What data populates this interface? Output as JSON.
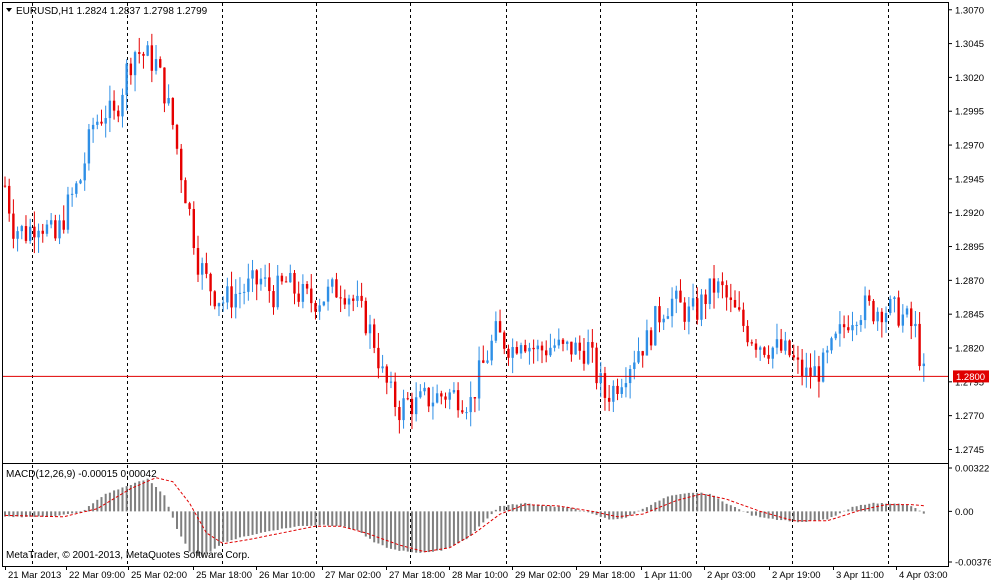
{
  "chart_data": [
    {
      "type": "candlestick",
      "symbol_header": "EURUSD,H1  1.2824 1.2837 1.2798 1.2799",
      "y_ticks": [
        "1.3070",
        "1.3045",
        "1.3020",
        "1.2995",
        "1.2970",
        "1.2945",
        "1.2920",
        "1.2895",
        "1.2870",
        "1.2845",
        "1.2820",
        "1.2795",
        "1.2770",
        "1.2745"
      ],
      "ylim": [
        1.2735,
        1.3075
      ],
      "current_price": "1.2800",
      "current_price_value": 1.2799,
      "x_ticks": [
        "21 Mar 2013",
        "22 Mar 09:00",
        "25 Mar 02:00",
        "25 Mar 18:00",
        "26 Mar 10:00",
        "27 Mar 02:00",
        "27 Mar 18:00",
        "28 Mar 10:00",
        "29 Mar 02:00",
        "29 Mar 18:00",
        "1 Apr 11:00",
        "2 Apr 03:00",
        "2 Apr 19:00",
        "3 Apr 11:00",
        "4 Apr 03:00"
      ],
      "close_path": [
        [
          0,
          1.294
        ],
        [
          2,
          1.291
        ],
        [
          5,
          1.2905
        ],
        [
          8,
          1.2915
        ],
        [
          12,
          1.29
        ],
        [
          15,
          1.2925
        ],
        [
          18,
          1.2945
        ],
        [
          21,
          1.2985
        ],
        [
          24,
          1.2995
        ],
        [
          26,
          1.299
        ],
        [
          29,
          1.3025
        ],
        [
          31,
          1.304
        ],
        [
          34,
          1.3035
        ],
        [
          36,
          1.303
        ],
        [
          38,
          1.301
        ],
        [
          40,
          1.2985
        ],
        [
          42,
          1.295
        ],
        [
          44,
          1.292
        ],
        [
          46,
          1.2885
        ],
        [
          48,
          1.287
        ],
        [
          50,
          1.286
        ],
        [
          52,
          1.2855
        ],
        [
          55,
          1.286
        ],
        [
          58,
          1.2865
        ],
        [
          61,
          1.287
        ],
        [
          64,
          1.286
        ],
        [
          67,
          1.2868
        ],
        [
          70,
          1.286
        ],
        [
          73,
          1.2855
        ],
        [
          76,
          1.2858
        ],
        [
          78,
          1.2862
        ],
        [
          80,
          1.2865
        ],
        [
          82,
          1.286
        ],
        [
          84,
          1.285
        ],
        [
          86,
          1.284
        ],
        [
          88,
          1.2825
        ],
        [
          90,
          1.28
        ],
        [
          92,
          1.2785
        ],
        [
          94,
          1.2775
        ],
        [
          96,
          1.278
        ],
        [
          98,
          1.2778
        ],
        [
          100,
          1.2782
        ],
        [
          102,
          1.2783
        ],
        [
          105,
          1.2786
        ],
        [
          108,
          1.2785
        ],
        [
          111,
          1.278
        ],
        [
          113,
          1.28
        ],
        [
          115,
          1.2815
        ],
        [
          117,
          1.283
        ],
        [
          119,
          1.2825
        ],
        [
          121,
          1.282
        ],
        [
          123,
          1.283
        ],
        [
          125,
          1.2822
        ],
        [
          127,
          1.2818
        ],
        [
          129,
          1.282
        ],
        [
          131,
          1.2822
        ],
        [
          133,
          1.2818
        ],
        [
          135,
          1.282
        ],
        [
          137,
          1.2818
        ],
        [
          139,
          1.282
        ],
        [
          141,
          1.28
        ],
        [
          143,
          1.2785
        ],
        [
          145,
          1.279
        ],
        [
          147,
          1.28
        ],
        [
          149,
          1.281
        ],
        [
          151,
          1.282
        ],
        [
          153,
          1.2825
        ],
        [
          155,
          1.284
        ],
        [
          157,
          1.285
        ],
        [
          159,
          1.2855
        ],
        [
          161,
          1.285
        ],
        [
          163,
          1.2845
        ],
        [
          165,
          1.2848
        ],
        [
          167,
          1.2858
        ],
        [
          169,
          1.2865
        ],
        [
          171,
          1.2862
        ],
        [
          173,
          1.285
        ],
        [
          175,
          1.2842
        ],
        [
          177,
          1.2832
        ],
        [
          179,
          1.2826
        ],
        [
          181,
          1.2822
        ],
        [
          183,
          1.282
        ],
        [
          185,
          1.2818
        ],
        [
          187,
          1.2815
        ],
        [
          189,
          1.2805
        ],
        [
          191,
          1.28
        ],
        [
          193,
          1.2802
        ],
        [
          195,
          1.2806
        ],
        [
          197,
          1.2818
        ],
        [
          199,
          1.283
        ],
        [
          201,
          1.2842
        ],
        [
          203,
          1.2848
        ],
        [
          205,
          1.285
        ],
        [
          207,
          1.2848
        ],
        [
          209,
          1.285
        ],
        [
          211,
          1.2848
        ],
        [
          213,
          1.2846
        ],
        [
          215,
          1.284
        ],
        [
          217,
          1.2832
        ],
        [
          219,
          1.2799
        ]
      ],
      "bars_count": 220
    },
    {
      "type": "macd",
      "label": "MACD(12,26,9) -0.00015 0.00042",
      "y_ticks": [
        "0.00322",
        "0.00",
        "-0.00376"
      ],
      "ylim": [
        -0.00376,
        0.00322
      ],
      "hist_path": [
        [
          0,
          -0.0004
        ],
        [
          10,
          -0.0004
        ],
        [
          18,
          -0.0001
        ],
        [
          24,
          0.0013
        ],
        [
          31,
          0.0021
        ],
        [
          34,
          0.0024
        ],
        [
          38,
          0.0012
        ],
        [
          41,
          -0.0013
        ],
        [
          44,
          -0.003
        ],
        [
          47,
          -0.0034
        ],
        [
          52,
          -0.0023
        ],
        [
          58,
          -0.0018
        ],
        [
          64,
          -0.0014
        ],
        [
          70,
          -0.0011
        ],
        [
          76,
          -0.001
        ],
        [
          80,
          -0.0011
        ],
        [
          84,
          -0.0014
        ],
        [
          88,
          -0.0023
        ],
        [
          92,
          -0.0028
        ],
        [
          98,
          -0.0031
        ],
        [
          104,
          -0.0029
        ],
        [
          110,
          -0.0021
        ],
        [
          114,
          -0.0008
        ],
        [
          118,
          0.0004
        ],
        [
          124,
          0.0006
        ],
        [
          130,
          0.0004
        ],
        [
          136,
          0.0002
        ],
        [
          140,
          -0.0002
        ],
        [
          144,
          -0.0006
        ],
        [
          148,
          -0.0005
        ],
        [
          152,
          0.0002
        ],
        [
          158,
          0.0011
        ],
        [
          164,
          0.0014
        ],
        [
          168,
          0.0013
        ],
        [
          172,
          0.0006
        ],
        [
          178,
          -0.0003
        ],
        [
          184,
          -0.0006
        ],
        [
          190,
          -0.0008
        ],
        [
          196,
          -0.0006
        ],
        [
          202,
          0.0003
        ],
        [
          206,
          0.0006
        ],
        [
          212,
          0.0006
        ],
        [
          216,
          0.0004
        ],
        [
          219,
          -0.00015
        ]
      ],
      "signal_path": [
        [
          0,
          -0.0003
        ],
        [
          14,
          -0.0004
        ],
        [
          22,
          0.0002
        ],
        [
          30,
          0.0017
        ],
        [
          36,
          0.0025
        ],
        [
          40,
          0.0022
        ],
        [
          44,
          0.0006
        ],
        [
          48,
          -0.0016
        ],
        [
          52,
          -0.0024
        ],
        [
          58,
          -0.0021
        ],
        [
          66,
          -0.0016
        ],
        [
          74,
          -0.0011
        ],
        [
          80,
          -0.0011
        ],
        [
          86,
          -0.0016
        ],
        [
          94,
          -0.0025
        ],
        [
          100,
          -0.003
        ],
        [
          106,
          -0.0027
        ],
        [
          112,
          -0.0016
        ],
        [
          118,
          -0.0002
        ],
        [
          124,
          0.0005
        ],
        [
          132,
          0.0004
        ],
        [
          140,
          0.0
        ],
        [
          146,
          -0.0004
        ],
        [
          152,
          -0.0002
        ],
        [
          160,
          0.0008
        ],
        [
          166,
          0.0013
        ],
        [
          172,
          0.0009
        ],
        [
          180,
          0.0
        ],
        [
          188,
          -0.0007
        ],
        [
          196,
          -0.0007
        ],
        [
          204,
          0.0001
        ],
        [
          210,
          0.0005
        ],
        [
          216,
          0.0005
        ],
        [
          219,
          0.00042
        ]
      ]
    }
  ],
  "copyright": "MetaTrader, © 2001-2013, MetaQuotes Software Corp.",
  "colors": {
    "bull": "#2e8fe6",
    "bear": "#e60000",
    "grid": "#000000",
    "price_line": "#e00000",
    "macd_hist": "#7f7f7f",
    "macd_signal": "#e00000"
  }
}
